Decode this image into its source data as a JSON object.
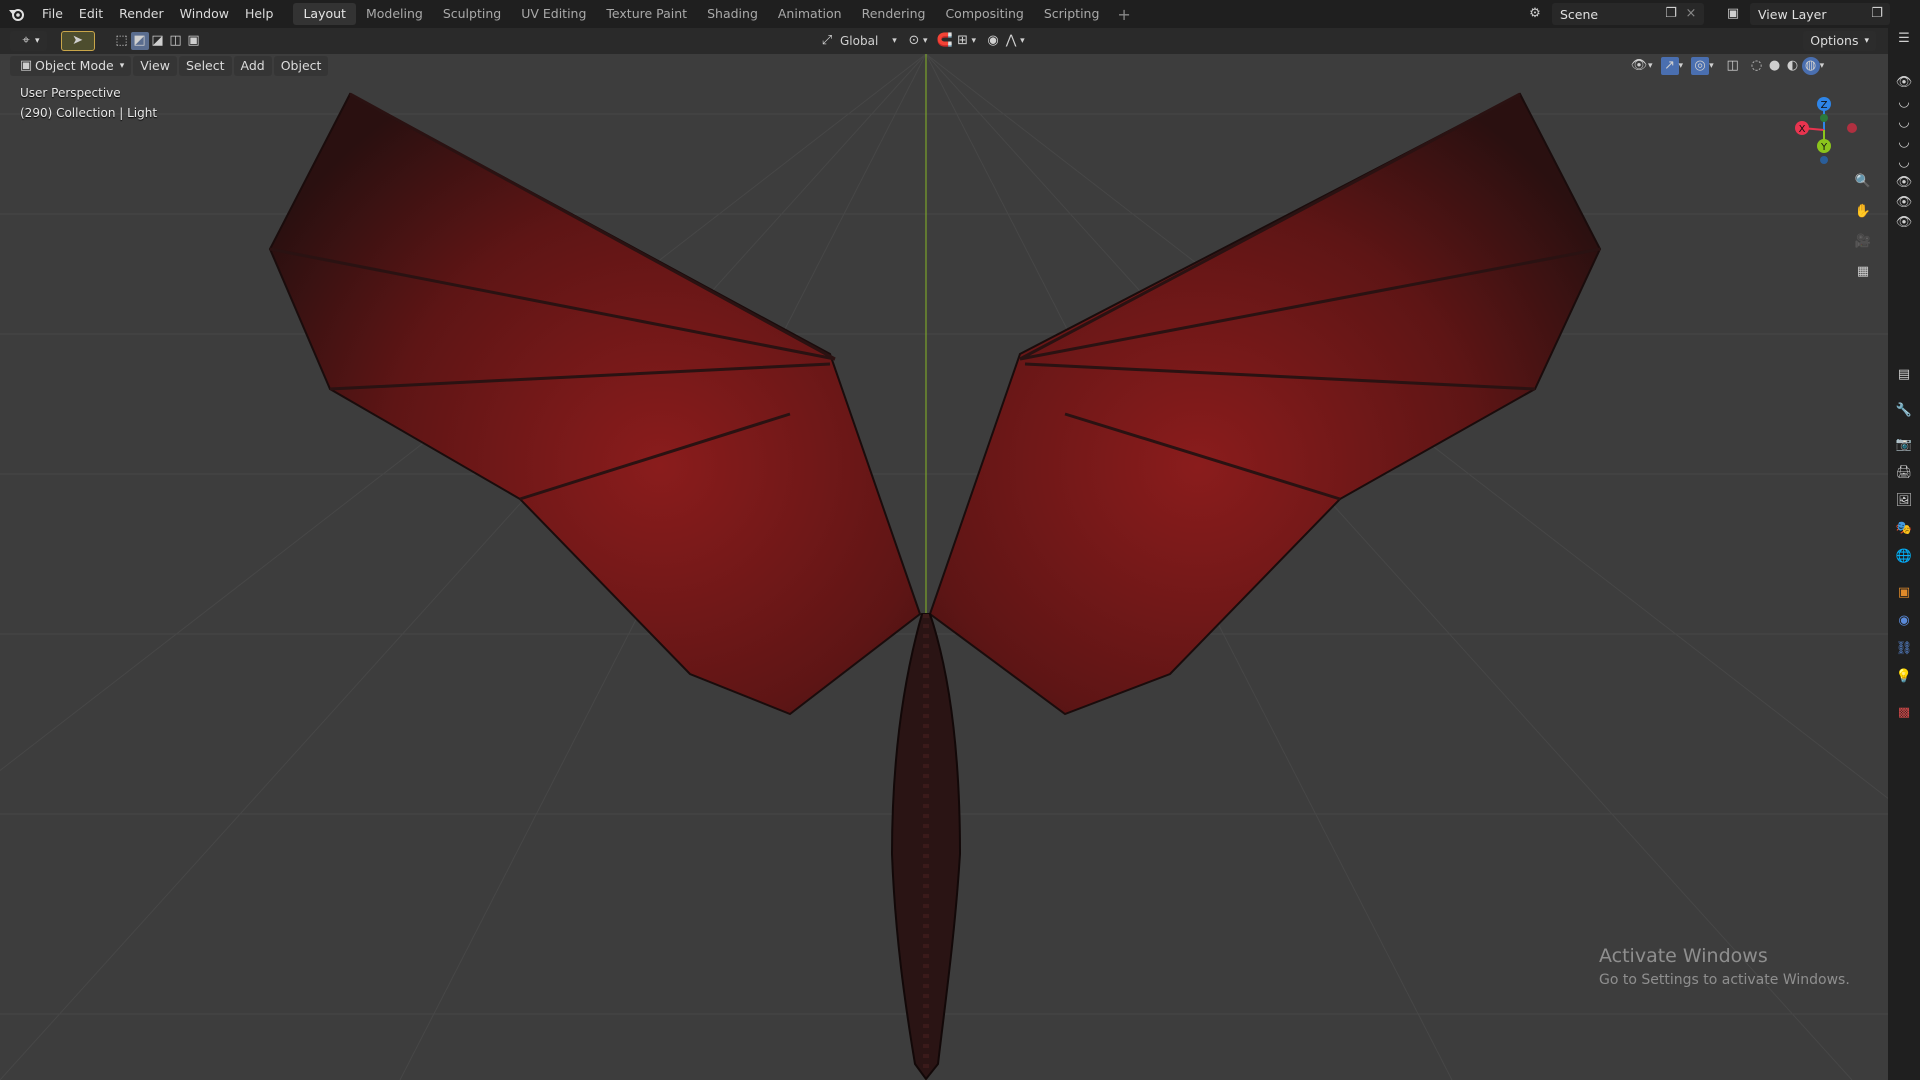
{
  "topbar": {
    "menus": [
      "File",
      "Edit",
      "Render",
      "Window",
      "Help"
    ],
    "workspace_tabs": [
      "Layout",
      "Modeling",
      "Sculpting",
      "UV Editing",
      "Texture Paint",
      "Shading",
      "Animation",
      "Rendering",
      "Compositing",
      "Scripting"
    ],
    "active_tab": "Layout",
    "add_tab": "+",
    "scene_name": "Scene",
    "view_layer_name": "View Layer"
  },
  "header2": {
    "transform_orientation": "Global",
    "options_label": "Options"
  },
  "header3": {
    "mode": "Object Mode",
    "menus": [
      "View",
      "Select",
      "Add",
      "Object"
    ]
  },
  "viewport": {
    "view_name": "User Perspective",
    "collection_info": "(290) Collection | Light",
    "gizmo_axes": {
      "z": "Z",
      "x": "X",
      "y": "Y"
    }
  },
  "colors": {
    "axis_x": "#e8344f",
    "axis_y": "#8bc51c",
    "axis_z": "#2e85e8",
    "background": "#3d3d3d",
    "dragon_red": "#7a1a1a"
  },
  "watermark": {
    "title": "Activate Windows",
    "subtitle": "Go to Settings to activate Windows."
  },
  "icons": {
    "blender_logo": "blender-logo-icon",
    "editor_type": "3d-viewport-icon",
    "select_tool": "cursor-select-icon",
    "zoom": "zoom-icon",
    "pan": "hand-icon",
    "camera": "camera-icon",
    "perspective": "grid-icon"
  }
}
